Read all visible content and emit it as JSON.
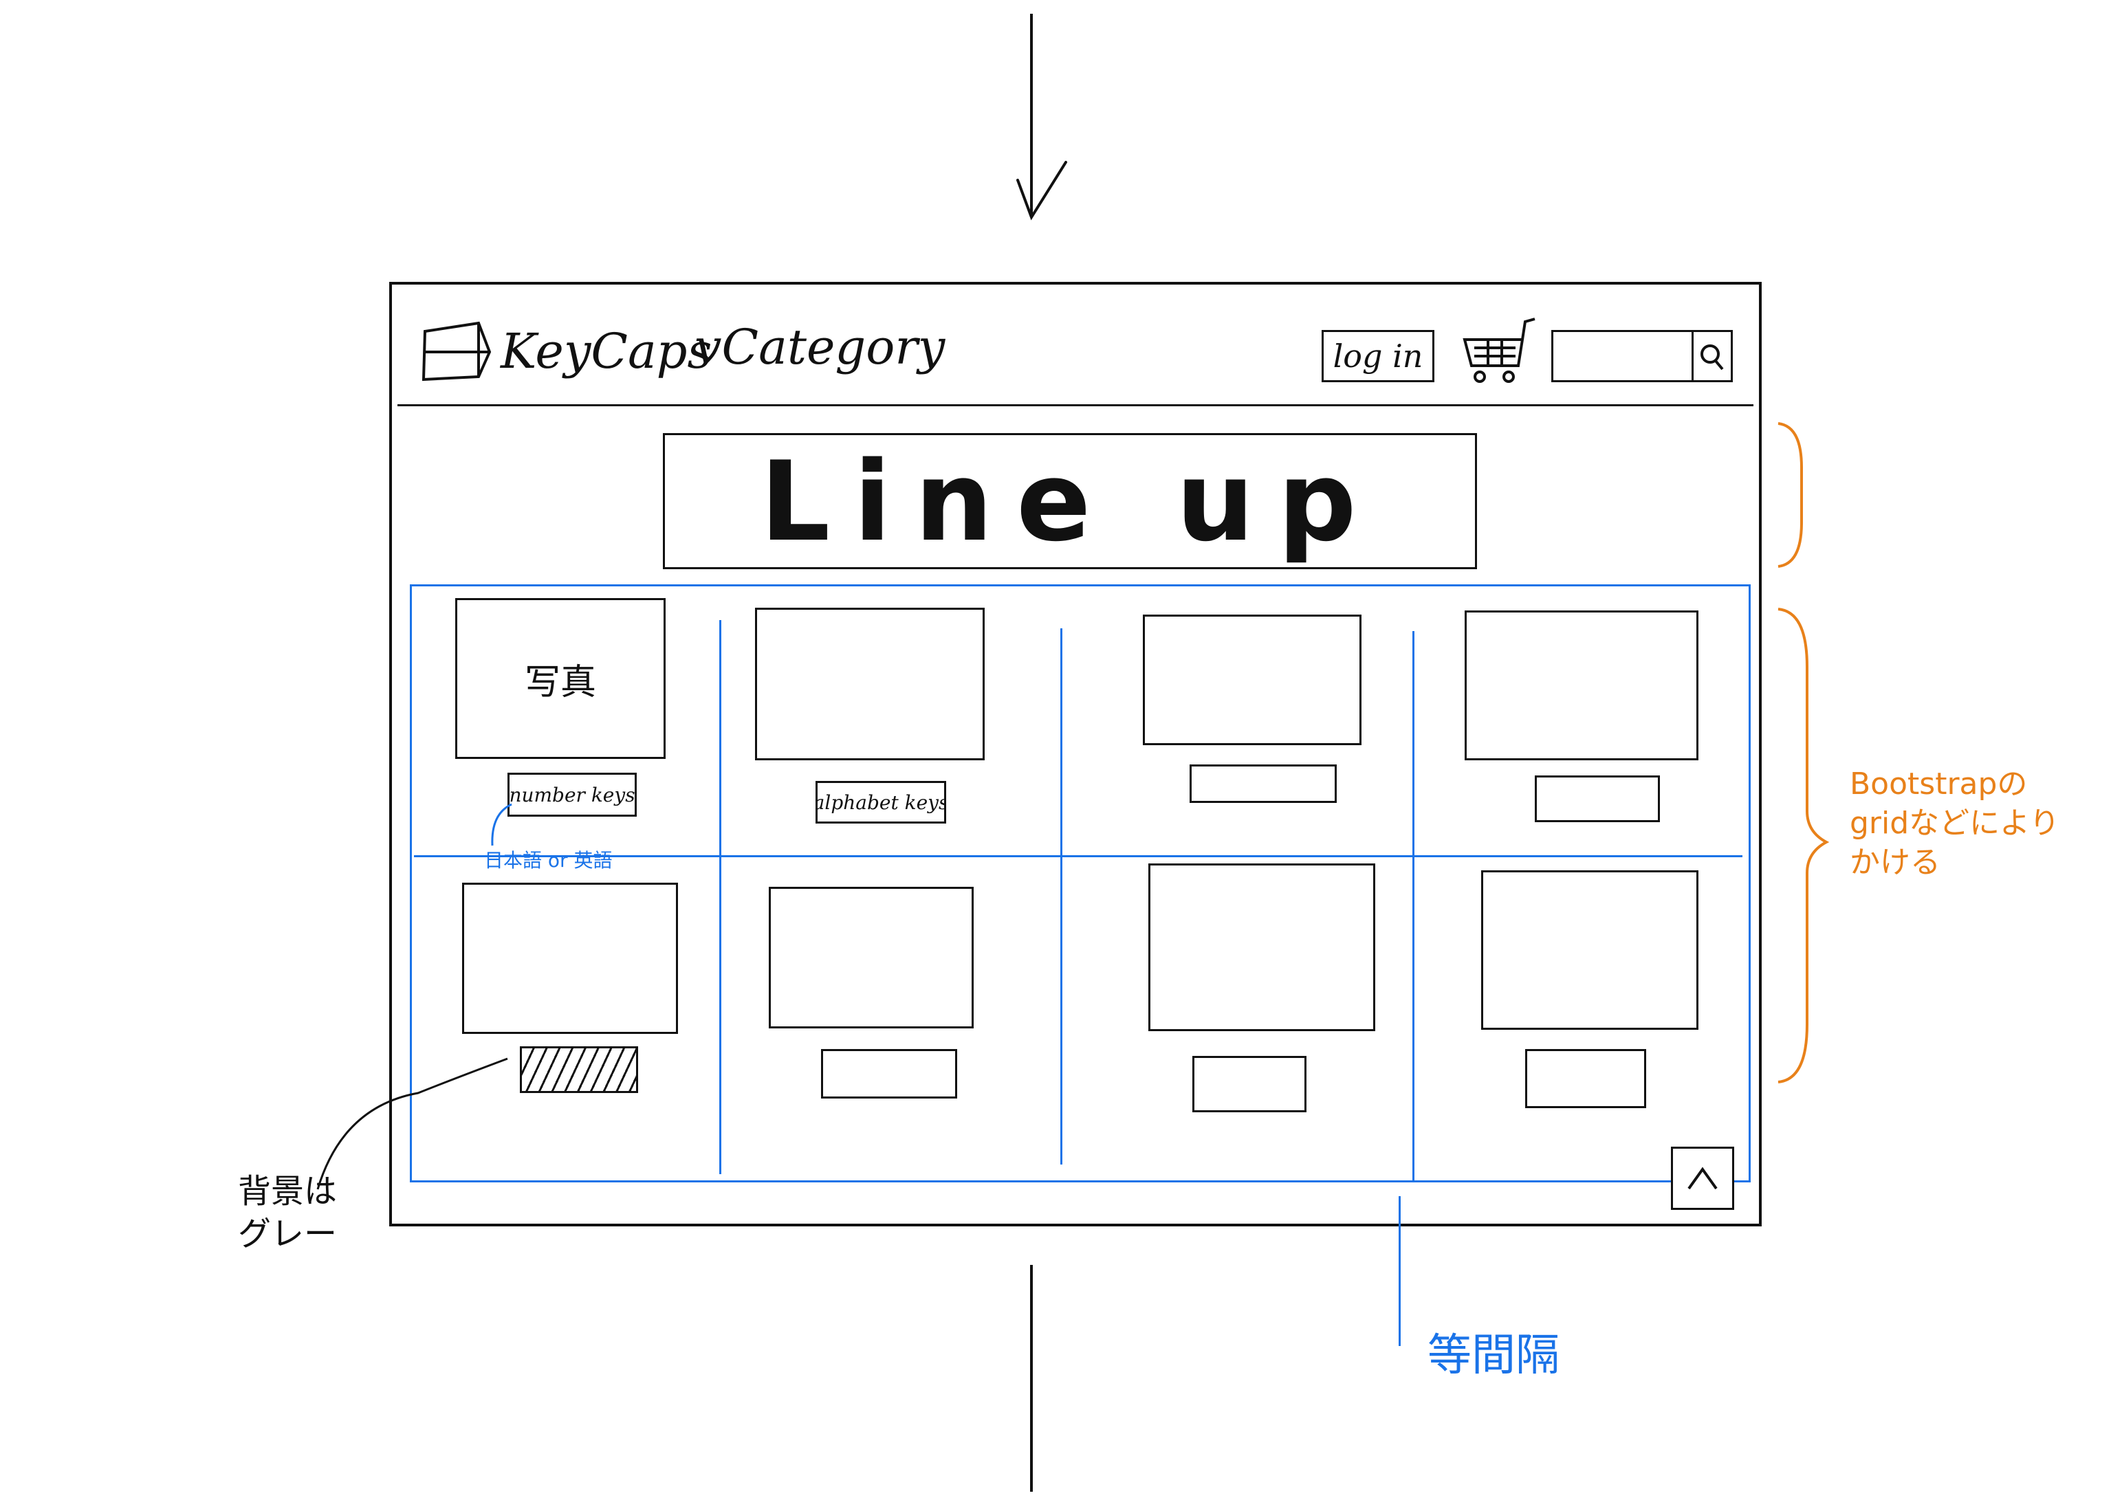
{
  "header": {
    "brand": "KeyCaps",
    "category_menu": "vCategory",
    "login_label": "log in"
  },
  "banner": {
    "title": "Line up"
  },
  "products": [
    {
      "photo_label": "写真",
      "name": "number keys"
    },
    {
      "photo_label": "",
      "name": "alphabet keys"
    },
    {
      "photo_label": "",
      "name": ""
    },
    {
      "photo_label": "",
      "name": ""
    },
    {
      "photo_label": "",
      "name": ""
    },
    {
      "photo_label": "",
      "name": ""
    },
    {
      "photo_label": "",
      "name": ""
    },
    {
      "photo_label": "",
      "name": ""
    }
  ],
  "annotations": {
    "label_language": "日本語 or 英語",
    "background_note": "背景はグレー",
    "bootstrap_note": "Bootstrapのgridなどによりかける",
    "equal_spacing": "等間隔"
  },
  "colors": {
    "annotation_blue": "#1a73e8",
    "annotation_orange": "#e8811a",
    "ink": "#111111"
  },
  "icons": [
    "keycap-logo-icon",
    "cart-icon",
    "search-icon",
    "chevron-up-icon",
    "arrow-down-icon"
  ]
}
